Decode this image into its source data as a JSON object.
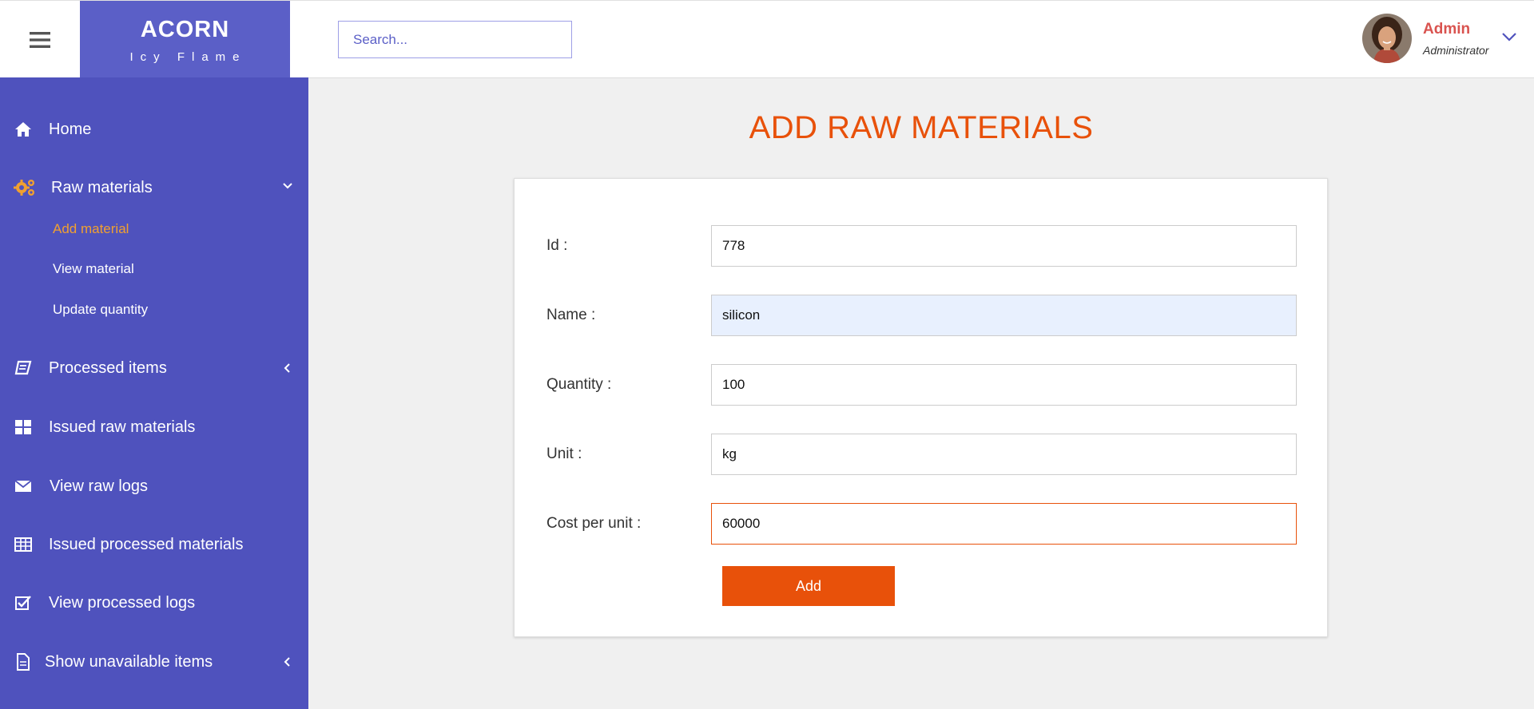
{
  "brand": {
    "name": "ACORN",
    "tagline": "Icy Flame"
  },
  "search": {
    "placeholder": "Search..."
  },
  "user": {
    "name": "Admin",
    "role": "Administrator"
  },
  "sidebar": {
    "items": [
      {
        "label": "Home",
        "icon": "home-icon"
      },
      {
        "label": "Raw materials",
        "icon": "gears-icon",
        "expanded": true,
        "children": [
          {
            "label": "Add material",
            "active": true
          },
          {
            "label": "View material"
          },
          {
            "label": "Update quantity"
          }
        ]
      },
      {
        "label": "Processed items",
        "icon": "book-icon"
      },
      {
        "label": "Issued raw materials",
        "icon": "grid-icon"
      },
      {
        "label": "View raw logs",
        "icon": "envelope-icon"
      },
      {
        "label": "Issued processed materials",
        "icon": "table-icon"
      },
      {
        "label": "View processed logs",
        "icon": "check-square-icon"
      },
      {
        "label": "Show unavailable items",
        "icon": "file-icon"
      }
    ]
  },
  "main": {
    "title": "ADD RAW MATERIALS",
    "form": {
      "fields": [
        {
          "label": "Id :",
          "value": "778"
        },
        {
          "label": "Name :",
          "value": "silicon"
        },
        {
          "label": "Quantity :",
          "value": "100"
        },
        {
          "label": "Unit :",
          "value": "kg"
        },
        {
          "label": "Cost per unit :",
          "value": "60000"
        }
      ],
      "submit_label": "Add"
    }
  },
  "colors": {
    "sidebar": "#4f52bd",
    "brand": "#5b5fc7",
    "accent": "#e8510a",
    "active_sub": "#f0a030",
    "user_name": "#d9534f"
  }
}
